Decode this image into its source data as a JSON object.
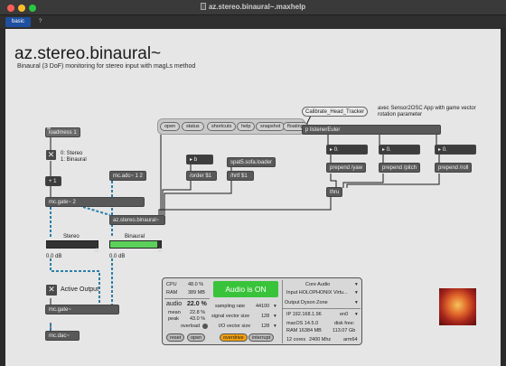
{
  "window": {
    "title": "az.stereo.binaural~.maxhelp",
    "tabs": [
      "basic",
      "?"
    ],
    "traffic_colors": [
      "#ff5f57",
      "#febc2e",
      "#28c840"
    ]
  },
  "help": {
    "title": "az.stereo.binaural~",
    "subtitle": "Binaural (3 DoF) monitoring for stereo input with magLs method"
  },
  "patch": {
    "loadmess": "loadmess 1",
    "toggle_comment_line1": "0: Stereo",
    "toggle_comment_line2": "1: Binaural",
    "plus": "+ 1",
    "mc_adc": "mc.adc~ 1 2",
    "mc_gate2": "mc.gate~ 2",
    "binaural": "az.stereo.binaural~",
    "stereo_label": "Stereo",
    "binaural_label": "Binaural",
    "stereo_db": "0.0 dB",
    "binaural_db": "0.0 dB",
    "stereo_level": 0.0,
    "binaural_level": 0.92,
    "pills": [
      "open",
      "status",
      "shortcuts",
      "help",
      "snapshot",
      "floating"
    ],
    "num_b": "b",
    "order_msg": "/order $1",
    "spat5": "spat5.sofa.loader",
    "hrtf_msg": "/hrtf $1",
    "calibrate": "Calibrate_Head_Tracker",
    "avec_comment": "avec Sensor2OSC App with game vector rotation parameter",
    "listener": "p listenerEuler",
    "num1": "0.",
    "num2": "0.",
    "num3": "0.",
    "yaw": "prepend /yaw",
    "pitch": "prepend /pitch",
    "roll": "prepend /roll",
    "thru": "thru",
    "active_output": "Active Output",
    "mc_gate": "mc.gate~",
    "mc_dac": "mc.dac~"
  },
  "audio_status": {
    "cpu_label": "CPU",
    "cpu_value": "48.0 %",
    "ram_label": "RAM",
    "ram_value": "389 MB",
    "audio_label": "audio",
    "audio_value": "22.0 %",
    "mean_label": "mean",
    "mean_value": "22.8 %",
    "peak_label": "peak",
    "peak_value": "43.0 %",
    "overload": "overload",
    "reset": "reset",
    "open": "open",
    "audio_on": "Audio is ON",
    "sampling_label": "sampling rate",
    "sampling_value": "44100",
    "svs_label": "signal vector size",
    "svs_value": "128",
    "io_label": "I/O vector size",
    "io_value": "128",
    "overdrive": "overdrive",
    "interrupt": "interrupt",
    "driver": "Core Audio",
    "input": "Input HOLOPHONIX Virtu...",
    "output": "Output Dyson Zone",
    "ip": "IP 192.168.1.96",
    "ip_mode": "en0",
    "macos": "macOS 14.5.0",
    "disk_label": "disk free:",
    "ram_detail": "RAM 16384 MB",
    "disk_value": "113.07 Gb",
    "cores": "12 cores",
    "mhz": "2400 Mhz",
    "arch": "arm64"
  }
}
